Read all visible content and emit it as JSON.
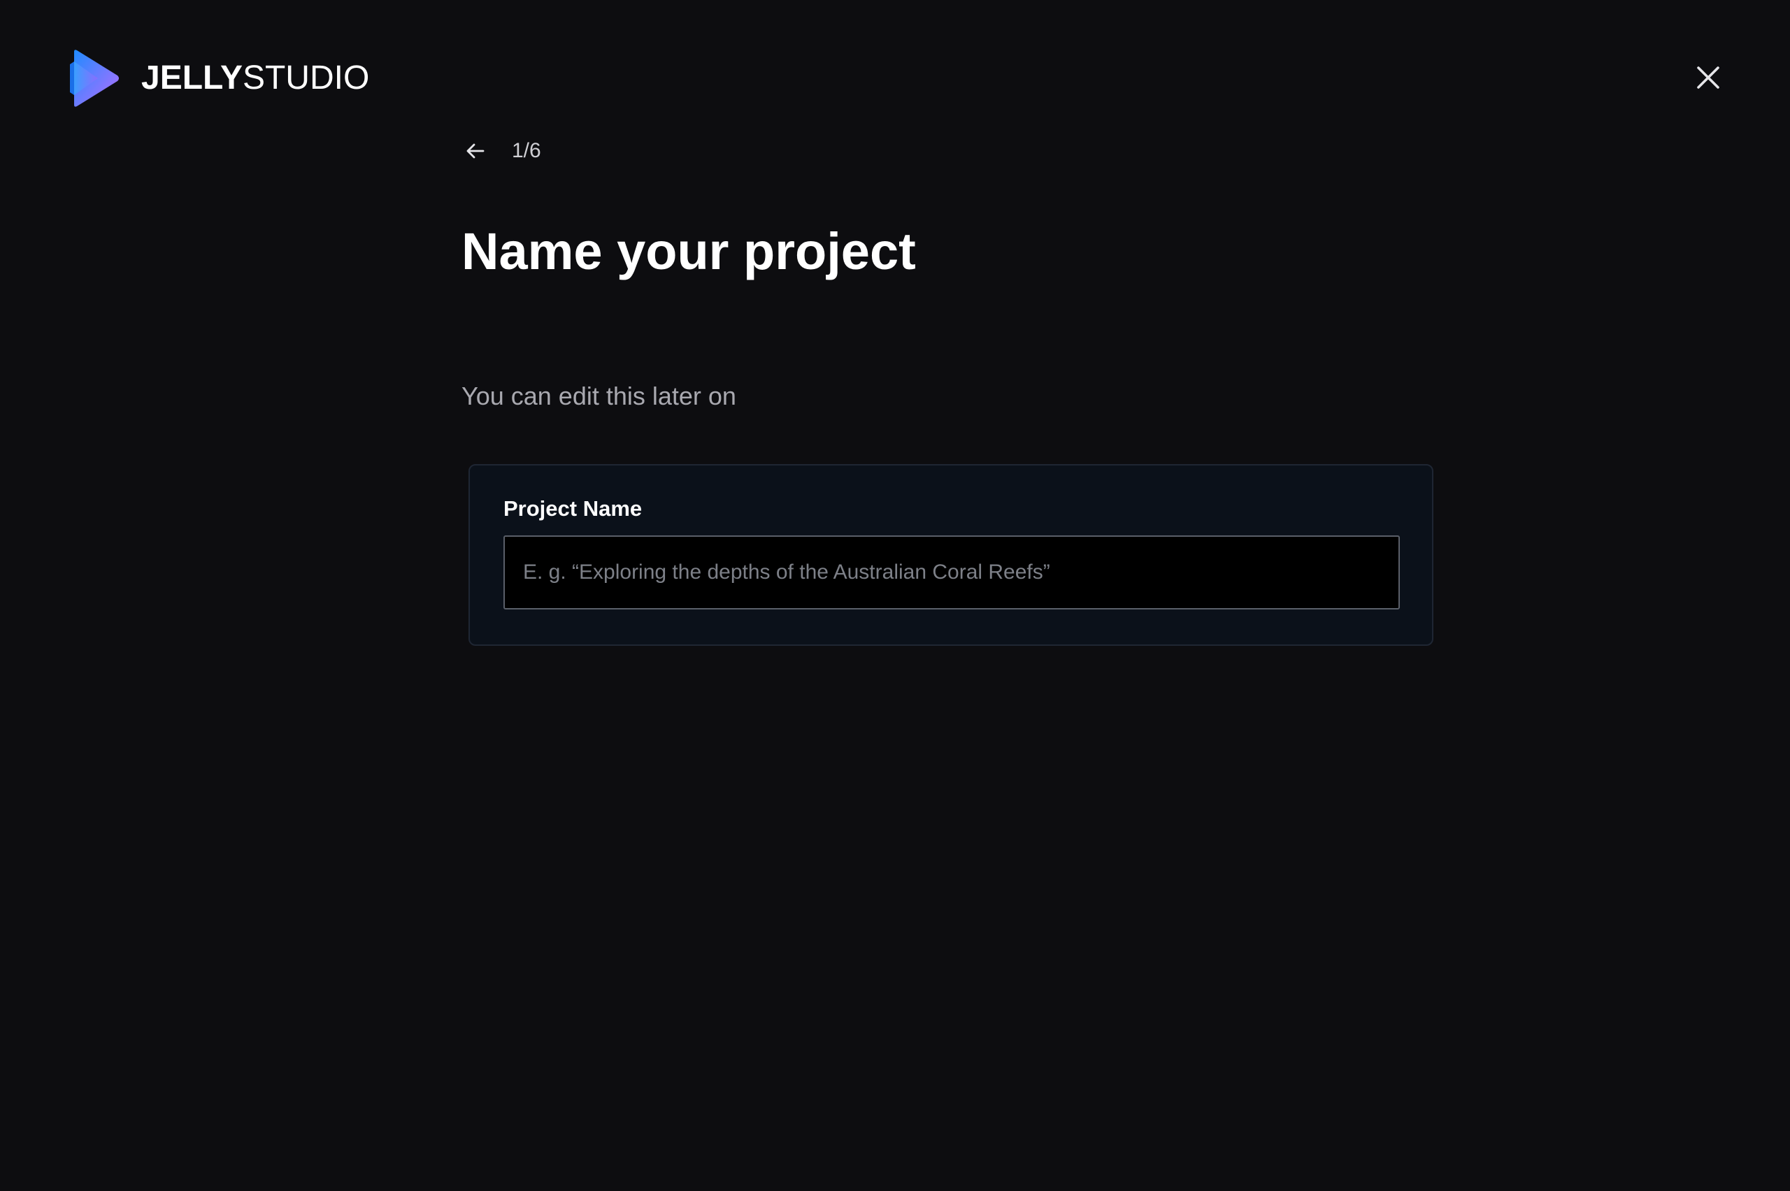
{
  "header": {
    "logo_bold": "JELLY",
    "logo_light": "STUDIO",
    "logo_icon": "play-triangle-logo",
    "close_icon": "close-icon"
  },
  "step_nav": {
    "back_icon": "arrow-left-icon",
    "step_count": "1/6"
  },
  "main": {
    "title": "Name your project",
    "subtitle": "You can edit this later on"
  },
  "form": {
    "label": "Project Name",
    "value": "",
    "placeholder": "E. g. “Exploring the depths of the Australian Coral Reefs”"
  },
  "colors": {
    "background": "#0d0d10",
    "card_background": "#0b111a",
    "logo_gradient_start": "#1f8bff",
    "logo_gradient_end": "#b66dff"
  }
}
